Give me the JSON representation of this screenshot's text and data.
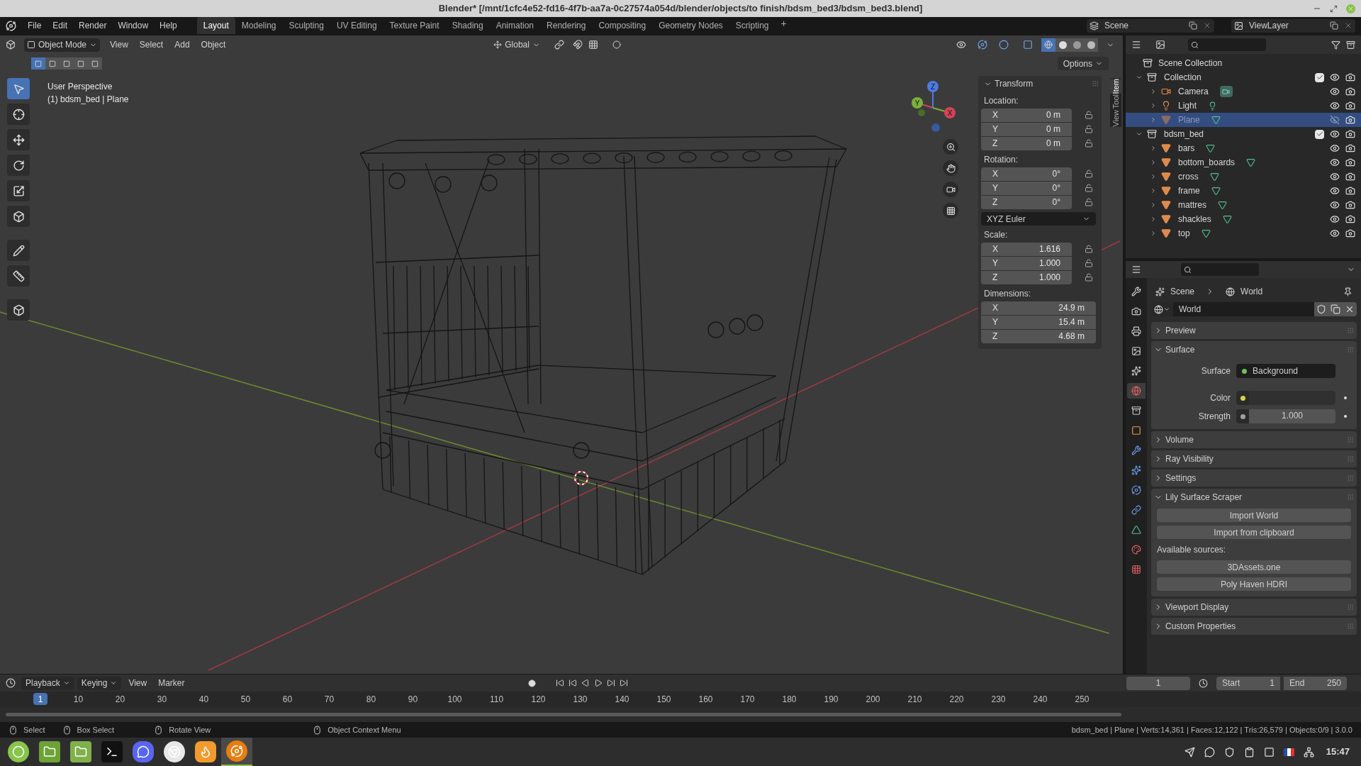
{
  "window": {
    "title": "Blender* [/mnt/1cfc4e52-fd16-4f7b-aa7a-0c27574a054d/blender/objects/to finish/bdsm_bed3/bdsm_bed3.blend]"
  },
  "menus": [
    "File",
    "Edit",
    "Render",
    "Window",
    "Help"
  ],
  "workspaces": [
    {
      "label": "Layout",
      "selected": true
    },
    {
      "label": "Modeling",
      "selected": false
    },
    {
      "label": "Sculpting",
      "selected": false
    },
    {
      "label": "UV Editing",
      "selected": false
    },
    {
      "label": "Texture Paint",
      "selected": false
    },
    {
      "label": "Shading",
      "selected": false
    },
    {
      "label": "Animation",
      "selected": false
    },
    {
      "label": "Rendering",
      "selected": false
    },
    {
      "label": "Compositing",
      "selected": false
    },
    {
      "label": "Geometry Nodes",
      "selected": false
    },
    {
      "label": "Scripting",
      "selected": false
    }
  ],
  "add_workspace": "+",
  "scene": "Scene",
  "view_layer": "ViewLayer",
  "viewport": {
    "mode": "Object Mode",
    "menus": [
      "View",
      "Select",
      "Add",
      "Object"
    ],
    "orientation": "Global",
    "options": "Options",
    "select_modes": [
      {
        "selected": true
      },
      {
        "selected": false
      },
      {
        "selected": false
      },
      {
        "selected": false
      },
      {
        "selected": false
      }
    ],
    "shading_modes": [
      {
        "kind": "wireframe",
        "selected": true
      },
      {
        "kind": "solid",
        "selected": false
      },
      {
        "kind": "material",
        "selected": false
      },
      {
        "kind": "rendered",
        "selected": false
      }
    ],
    "xray": {
      "on": true
    },
    "overlay_lines": [
      "User Perspective",
      "(1) bdsm_bed | Plane"
    ],
    "gizmo_labels": [
      "Z",
      "Y",
      "X"
    ],
    "tools": [
      {
        "kind": "select",
        "selected": true
      },
      {
        "kind": "cursor",
        "selected": false
      },
      {
        "kind": "move",
        "selected": false
      },
      {
        "kind": "rotate",
        "selected": false
      },
      {
        "kind": "scale",
        "selected": false
      },
      {
        "kind": "transform",
        "selected": false
      },
      {
        "kind": "annotate",
        "selected": false
      },
      {
        "kind": "measure",
        "selected": false
      },
      {
        "kind": "add-cube",
        "selected": false
      }
    ],
    "side_tabs": [
      {
        "label": "Item",
        "selected": true
      },
      {
        "label": "Tool",
        "selected": false
      },
      {
        "label": "View",
        "selected": false
      }
    ],
    "transform": {
      "title": "Transform",
      "groups": [
        {
          "label": "Location:",
          "lockable": true,
          "rows": [
            {
              "axis": "X",
              "value": "0 m"
            },
            {
              "axis": "Y",
              "value": "0 m"
            },
            {
              "axis": "Z",
              "value": "0 m"
            }
          ]
        },
        {
          "label": "Rotation:",
          "lockable": true,
          "rows": [
            {
              "axis": "X",
              "value": "0°"
            },
            {
              "axis": "Y",
              "value": "0°"
            },
            {
              "axis": "Z",
              "value": "0°"
            }
          ],
          "mode": "XYZ Euler"
        },
        {
          "label": "Scale:",
          "lockable": true,
          "rows": [
            {
              "axis": "X",
              "value": "1.616"
            },
            {
              "axis": "Y",
              "value": "1.000"
            },
            {
              "axis": "Z",
              "value": "1.000"
            }
          ]
        },
        {
          "label": "Dimensions:",
          "lockable": false,
          "rows": [
            {
              "axis": "X",
              "value": "24.9 m"
            },
            {
              "axis": "Y",
              "value": "15.4 m"
            },
            {
              "axis": "Z",
              "value": "4.68 m"
            }
          ]
        }
      ]
    }
  },
  "outliner": {
    "root": "Scene Collection",
    "items": [
      {
        "name": "Collection",
        "kind": "collection",
        "expanded": true,
        "checked": true,
        "visible": true,
        "selected": false,
        "children": [
          {
            "name": "Camera",
            "kind": "camera",
            "expanded": false,
            "visible": true,
            "selected": false
          },
          {
            "name": "Light",
            "kind": "light",
            "expanded": false,
            "visible": true,
            "selected": false
          },
          {
            "name": "Plane",
            "kind": "mesh",
            "expanded": false,
            "visible": false,
            "selected": true
          }
        ]
      },
      {
        "name": "bdsm_bed",
        "kind": "collection",
        "expanded": true,
        "checked": true,
        "visible": true,
        "selected": false,
        "children": [
          {
            "name": "bars",
            "kind": "mesh",
            "expanded": false,
            "visible": true,
            "selected": false
          },
          {
            "name": "bottom_boards",
            "kind": "mesh",
            "expanded": false,
            "visible": true,
            "selected": false
          },
          {
            "name": "cross",
            "kind": "mesh",
            "expanded": false,
            "visible": true,
            "selected": false
          },
          {
            "name": "frame",
            "kind": "mesh",
            "expanded": false,
            "visible": true,
            "selected": false
          },
          {
            "name": "mattres",
            "kind": "mesh",
            "expanded": false,
            "visible": true,
            "selected": false
          },
          {
            "name": "shackles",
            "kind": "mesh",
            "expanded": false,
            "visible": true,
            "selected": false
          },
          {
            "name": "top",
            "kind": "mesh",
            "expanded": false,
            "visible": true,
            "selected": false
          }
        ]
      }
    ]
  },
  "properties": {
    "tabs": [
      {
        "kind": "tool",
        "selected": false
      },
      {
        "kind": "render",
        "selected": false
      },
      {
        "kind": "output",
        "selected": false
      },
      {
        "kind": "view-layer",
        "selected": false
      },
      {
        "kind": "scene",
        "selected": false
      },
      {
        "kind": "world",
        "selected": true
      },
      {
        "kind": "collection",
        "selected": false
      },
      {
        "kind": "object",
        "selected": false
      },
      {
        "kind": "modifier",
        "selected": false
      },
      {
        "kind": "particles",
        "selected": false
      },
      {
        "kind": "physics",
        "selected": false
      },
      {
        "kind": "constraints",
        "selected": false
      },
      {
        "kind": "data",
        "selected": false
      },
      {
        "kind": "material",
        "selected": false
      },
      {
        "kind": "texture",
        "selected": false
      }
    ],
    "breadcrumb": [
      "Scene",
      "World"
    ],
    "world": "World",
    "panels": [
      {
        "title": "Preview",
        "expanded": false
      },
      {
        "kind": "surface",
        "title": "Surface",
        "expanded": true,
        "fields": [
          {
            "kind": "shader",
            "label": "Surface",
            "value": "Background",
            "color": "#6fbf5f"
          },
          {
            "kind": "color",
            "label": "Color",
            "color": "#d9d34a"
          },
          {
            "kind": "number",
            "label": "Strength",
            "value": "1.000",
            "color": "#a0a0a0"
          }
        ]
      },
      {
        "title": "Volume",
        "expanded": false
      },
      {
        "title": "Ray Visibility",
        "expanded": false
      },
      {
        "title": "Settings",
        "expanded": false
      },
      {
        "kind": "scraper",
        "title": "Lily Surface Scraper",
        "expanded": true,
        "buttons": [
          "Import World",
          "Import from clipboard"
        ],
        "sources_label": "Available sources:",
        "sources": [
          "3DAssets.one",
          "Poly Haven HDRI"
        ]
      },
      {
        "title": "Viewport Display",
        "expanded": false
      },
      {
        "title": "Custom Properties",
        "expanded": false
      }
    ]
  },
  "timeline": {
    "menus": [
      {
        "label": "Playback",
        "dropdown": true
      },
      {
        "label": "Keying",
        "dropdown": true
      },
      {
        "label": "View",
        "dropdown": false
      },
      {
        "label": "Marker",
        "dropdown": false
      }
    ],
    "current_frame": "1",
    "start_label": "Start",
    "start": "1",
    "end_label": "End",
    "end": "250",
    "marker": "1",
    "ticks": [
      "10",
      "20",
      "30",
      "40",
      "50",
      "60",
      "70",
      "80",
      "90",
      "100",
      "110",
      "120",
      "130",
      "140",
      "150",
      "160",
      "170",
      "180",
      "190",
      "200",
      "210",
      "220",
      "230",
      "240",
      "250"
    ]
  },
  "status_bar": {
    "hints": [
      "Select",
      "Box Select",
      "Rotate View",
      "Object Context Menu"
    ],
    "stats": "bdsm_bed | Plane | Verts:14,361 | Faces:12,122 | Tris:26,579 | Objects:0/9 | 3.0.0"
  },
  "taskbar": {
    "apps": [
      {
        "kind": "menu",
        "selected": false
      },
      {
        "kind": "files",
        "selected": false
      },
      {
        "kind": "folder",
        "selected": false
      },
      {
        "kind": "terminal",
        "selected": false
      },
      {
        "kind": "chat",
        "selected": false
      },
      {
        "kind": "browser",
        "selected": false
      },
      {
        "kind": "fox",
        "selected": false
      },
      {
        "kind": "blender",
        "selected": true
      }
    ],
    "time": "15:47"
  }
}
